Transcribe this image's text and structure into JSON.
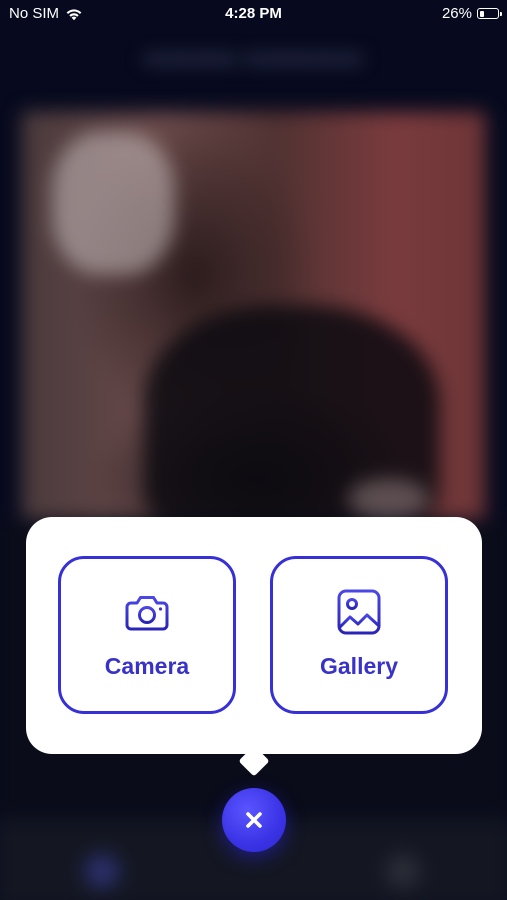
{
  "status_bar": {
    "carrier": "No SIM",
    "time": "4:28 PM",
    "battery_percent": "26%",
    "battery_level": 0.26,
    "wifi_icon": "wifi-icon",
    "battery_icon": "battery-icon"
  },
  "picker": {
    "options": [
      {
        "label": "Camera",
        "icon": "camera-icon"
      },
      {
        "label": "Gallery",
        "icon": "image-icon"
      }
    ],
    "close_icon": "close-icon"
  },
  "colors": {
    "accent": "#3630d6",
    "fab": "#3a33e6",
    "overlay_background": "#070a1e",
    "popup_background": "#ffffff"
  }
}
